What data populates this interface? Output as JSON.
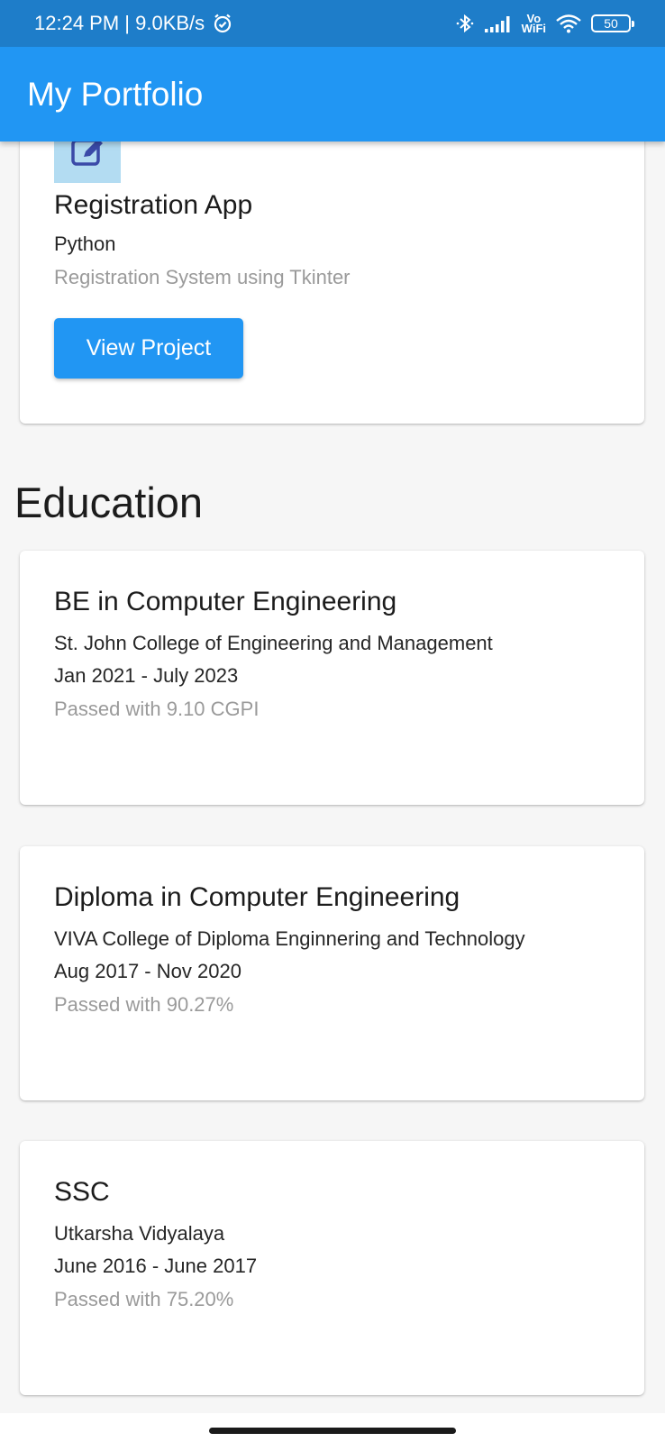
{
  "status_bar": {
    "time_speed": "12:24 PM | 9.0KB/s",
    "vowifi_top": "Vo",
    "vowifi_bottom": "WiFi",
    "battery": "50"
  },
  "app_bar": {
    "title": "My Portfolio"
  },
  "project": {
    "title": "Registration App",
    "language": "Python",
    "description": "Registration System using Tkinter",
    "button_label": "View Project",
    "icon": "edit-icon"
  },
  "education": {
    "heading": "Education",
    "items": [
      {
        "degree": "BE in Computer Engineering",
        "institution": "St. John College of Engineering and Management",
        "dates": "Jan 2021 - July 2023",
        "result": "Passed with 9.10 CGPI"
      },
      {
        "degree": "Diploma in Computer Engineering",
        "institution": "VIVA College of Diploma Enginnering and Technology",
        "dates": "Aug 2017 - Nov 2020",
        "result": "Passed with 90.27%"
      },
      {
        "degree": "SSC",
        "institution": "Utkarsha Vidyalaya",
        "dates": "June 2016 - June 2017",
        "result": "Passed with 75.20%"
      }
    ]
  },
  "colors": {
    "status_bar": "#1e7dc9",
    "app_bar": "#2196f3",
    "button": "#2196f3",
    "icon_bg": "#b3dcf2"
  }
}
